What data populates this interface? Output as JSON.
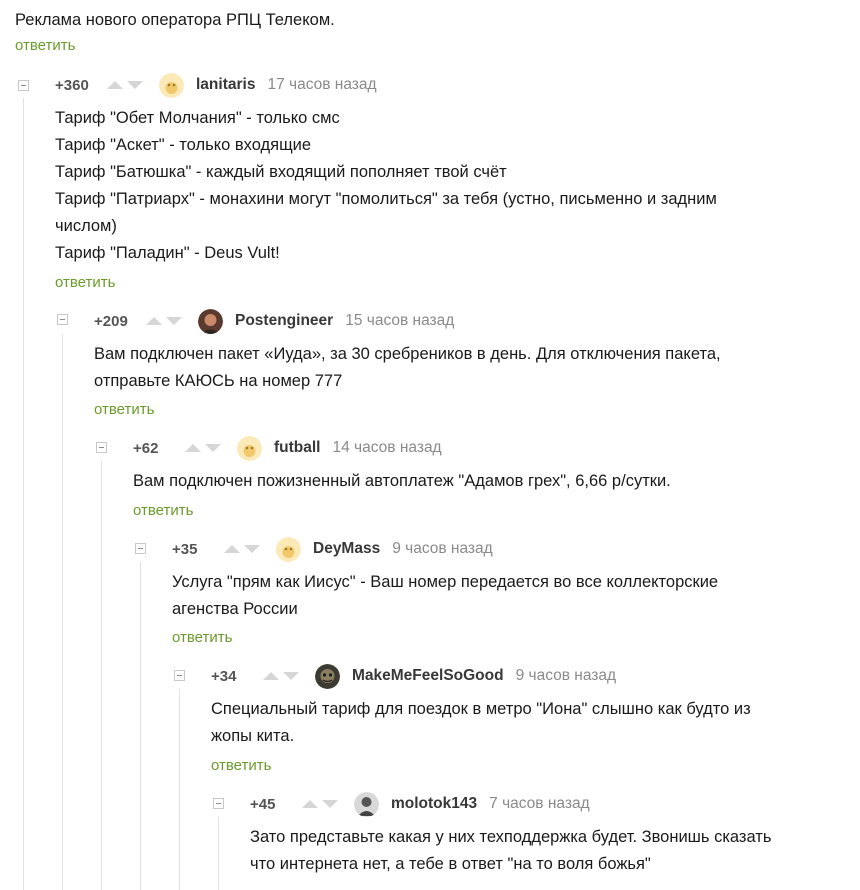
{
  "root": {
    "text": "Реклама нового оператора РПЦ Телеком.",
    "reply_label": "ответить"
  },
  "comments": [
    {
      "rating": "+360",
      "username": "lanitaris",
      "time": "17 часов назад",
      "avatar": "default-avatar-icon",
      "lines": [
        "Тариф \"Обет Молчания\" - только смс",
        "Тариф \"Аскет\" - только входящие",
        "Тариф \"Батюшка\" - каждый входящий пополняет твой счёт",
        "Тариф \"Патриарх\" - монахини могут \"помолиться\" за тебя (устно, письменно и задним",
        "числом)",
        "Тариф \"Паладин\" - Deus Vult!"
      ],
      "reply_label": "ответить"
    },
    {
      "rating": "+209",
      "username": "Postengineer",
      "time": "15 часов назад",
      "avatar": "user-photo-avatar",
      "lines": [
        "Вам подключен пакет «Иуда», за 30 сребреников в день. Для отключения пакета,",
        "отправьте КАЮСЬ на номер 777"
      ],
      "reply_label": "ответить"
    },
    {
      "rating": "+62",
      "username": "futball",
      "time": "14 часов назад",
      "avatar": "default-avatar-icon",
      "lines": [
        "Вам подключен пожизненный автоплатеж \"Адамов грех\", 6,66 р/сутки."
      ],
      "reply_label": "ответить"
    },
    {
      "rating": "+35",
      "username": "DeyMass",
      "time": "9 часов назад",
      "avatar": "default-avatar-icon",
      "lines": [
        "Услуга \"прям как Иисус\" - Ваш номер передается во все коллекторские",
        "агенства России"
      ],
      "reply_label": "ответить"
    },
    {
      "rating": "+34",
      "username": "MakeMeFeelSoGood",
      "time": "9 часов назад",
      "avatar": "user-photo-avatar",
      "lines": [
        "Специальный тариф для поездок в метро \"Иона\" слышно как будто из",
        "жопы кита."
      ],
      "reply_label": "ответить"
    },
    {
      "rating": "+45",
      "username": "molotok143",
      "time": "7 часов назад",
      "avatar": "user-photo-avatar",
      "lines": [
        "Зато представьте какая у них техподдержка будет. Звонишь сказать",
        "что интернета нет, а тебе в ответ \"на то воля божья\""
      ],
      "reply_label": ""
    }
  ]
}
